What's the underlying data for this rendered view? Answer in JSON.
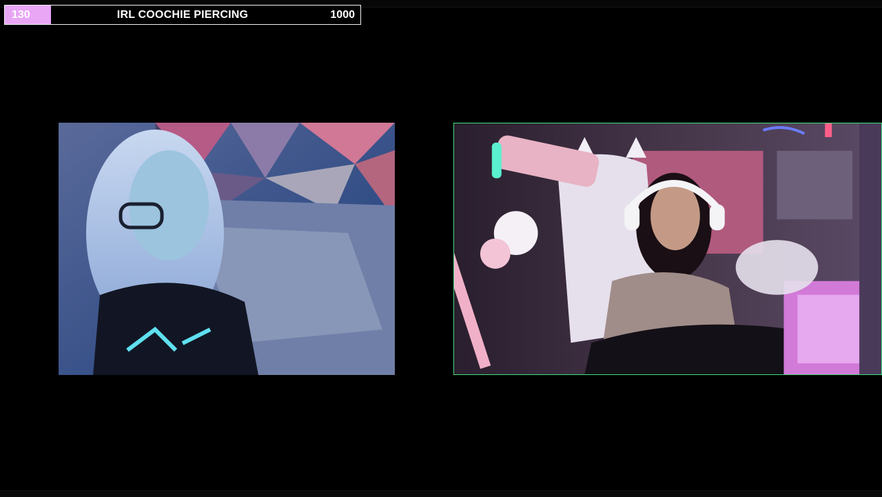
{
  "goal": {
    "current": "130",
    "title": "IRL COOCHIE PIERCING",
    "target": "1000",
    "progress_fraction": 0.13,
    "fill_color": "#e8a6f5",
    "border_color": "#f2f2f2"
  },
  "videos": {
    "left_feed": {
      "kind": "webcam-feed"
    },
    "right_feed": {
      "kind": "webcam-feed",
      "border_color": "#3ee07a"
    }
  }
}
